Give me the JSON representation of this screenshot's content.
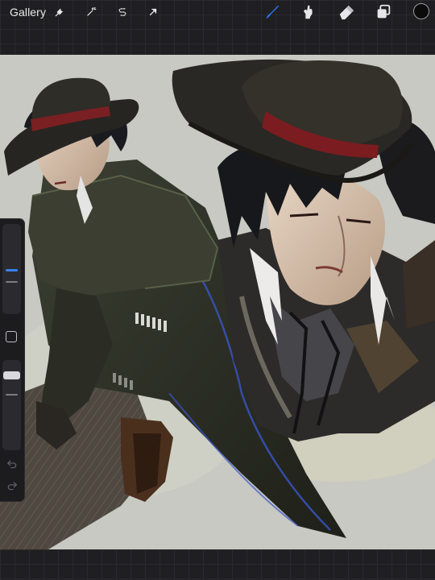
{
  "topbar": {
    "gallery_label": "Gallery",
    "actions": [
      {
        "name": "actions-wrench",
        "icon": "wrench-icon"
      },
      {
        "name": "adjustments-wand",
        "icon": "magic-wand-icon"
      },
      {
        "name": "selection-s",
        "icon": "selection-s-icon"
      },
      {
        "name": "transform-arrow",
        "icon": "transform-arrow-icon"
      }
    ],
    "tools": [
      {
        "name": "brush",
        "icon": "brush-icon",
        "active": true
      },
      {
        "name": "smudge",
        "icon": "smudge-finger-icon",
        "active": false
      },
      {
        "name": "eraser",
        "icon": "eraser-icon",
        "active": false
      },
      {
        "name": "layers",
        "icon": "layers-icon",
        "active": false
      }
    ],
    "color_swatch": "#0b0b0b",
    "active_color": "#2e7bff"
  },
  "sidebar": {
    "brush_size_level": 0.45,
    "opacity_level": 0.15,
    "modify_button": "square-icon",
    "undo": "undo-arrow-icon",
    "redo": "redo-arrow-icon"
  },
  "canvas": {
    "background": "#c8c9c3",
    "artwork": "painting-illustration"
  }
}
